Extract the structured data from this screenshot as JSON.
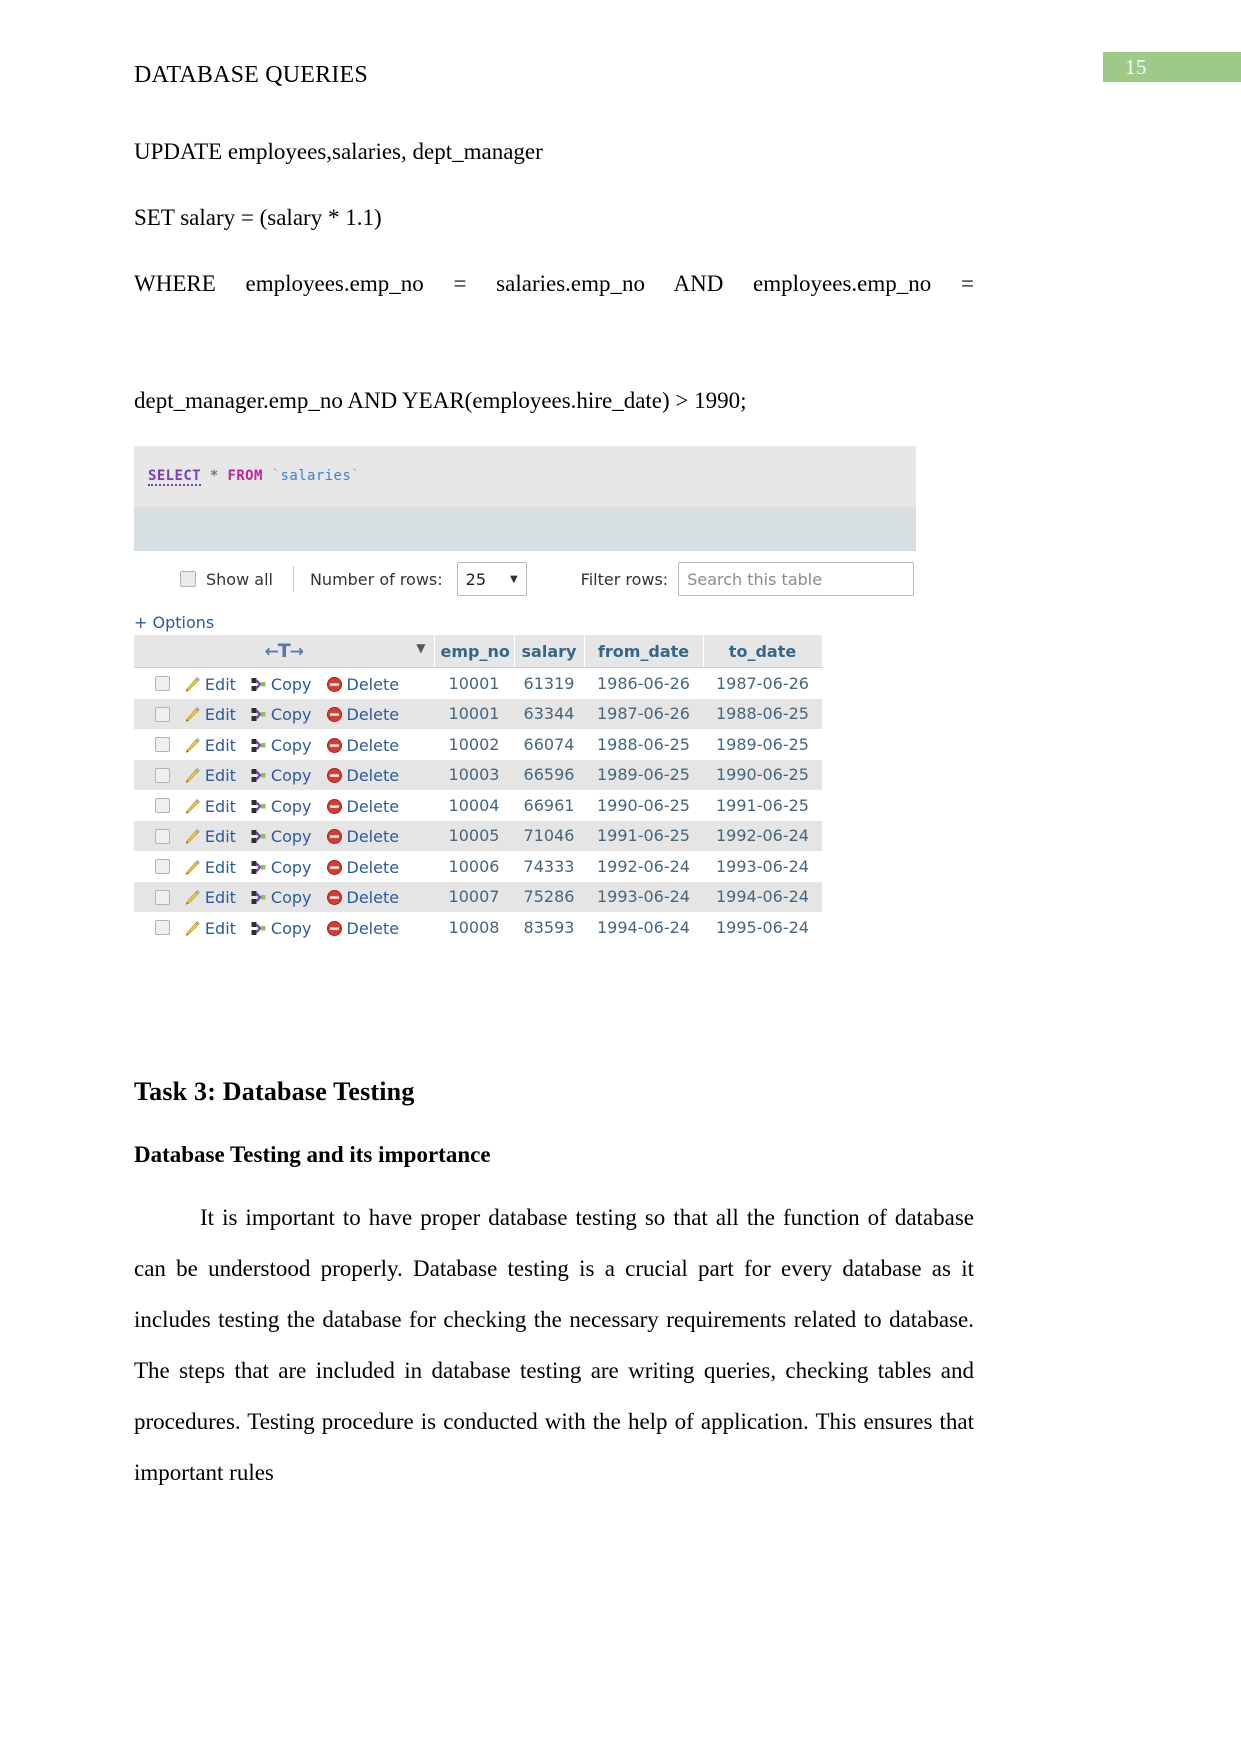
{
  "document": {
    "header_title": "DATABASE QUERIES",
    "page_number": "15",
    "page_badge_color": "#9dcb87"
  },
  "query_lines": {
    "line1": "UPDATE employees,salaries, dept_manager",
    "line2": "SET salary = (salary * 1.1)",
    "line3": "WHERE employees.emp_no = salaries.emp_no AND employees.emp_no =",
    "line4": "dept_manager.emp_no AND YEAR(employees.hire_date) > 1990;",
    "line5": "Select * From salaries;"
  },
  "phpmyadmin": {
    "sql_editor": {
      "keyword_select": "SELECT",
      "star": "*",
      "keyword_from": "FROM",
      "backtick_open": "`",
      "table_name": "salaries",
      "backtick_close": "`"
    },
    "controls": {
      "show_all_label": "Show all",
      "number_of_rows_label": "Number of rows:",
      "number_of_rows_value": "25",
      "filter_rows_label": "Filter rows:",
      "filter_placeholder": "Search this table"
    },
    "options_link": "+ Options",
    "nav_header": {
      "left_arrow": "←",
      "t_glyph": "T",
      "right_arrow": "→",
      "sort_caret": "▼"
    },
    "row_actions": {
      "edit": "Edit",
      "copy": "Copy",
      "delete": "Delete"
    },
    "columns": [
      "emp_no",
      "salary",
      "from_date",
      "to_date"
    ],
    "rows": [
      {
        "emp_no": "10001",
        "salary": "61319",
        "from_date": "1986-06-26",
        "to_date": "1987-06-26"
      },
      {
        "emp_no": "10001",
        "salary": "63344",
        "from_date": "1987-06-26",
        "to_date": "1988-06-25"
      },
      {
        "emp_no": "10002",
        "salary": "66074",
        "from_date": "1988-06-25",
        "to_date": "1989-06-25"
      },
      {
        "emp_no": "10003",
        "salary": "66596",
        "from_date": "1989-06-25",
        "to_date": "1990-06-25"
      },
      {
        "emp_no": "10004",
        "salary": "66961",
        "from_date": "1990-06-25",
        "to_date": "1991-06-25"
      },
      {
        "emp_no": "10005",
        "salary": "71046",
        "from_date": "1991-06-25",
        "to_date": "1992-06-24"
      },
      {
        "emp_no": "10006",
        "salary": "74333",
        "from_date": "1992-06-24",
        "to_date": "1993-06-24"
      },
      {
        "emp_no": "10007",
        "salary": "75286",
        "from_date": "1993-06-24",
        "to_date": "1994-06-24"
      },
      {
        "emp_no": "10008",
        "salary": "83593",
        "from_date": "1994-06-24",
        "to_date": "1995-06-24"
      }
    ]
  },
  "sections": {
    "task_heading": "Task 3: Database Testing",
    "sub_heading": "Database Testing and its importance",
    "body_paragraph": "It is important to have proper database testing so that all the function of database can be understood properly. Database testing is a crucial part for every database as it includes testing the database for checking the necessary requirements related to database. The steps that are included in database testing are writing queries, checking tables and procedures. Testing procedure is conducted with the help of application. This ensures that important rules"
  }
}
